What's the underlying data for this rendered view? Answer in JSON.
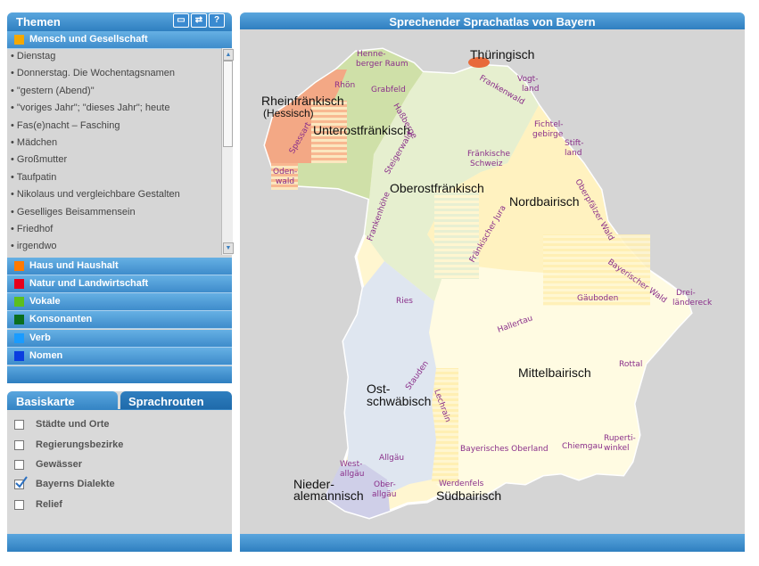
{
  "themes_panel": {
    "title": "Themen",
    "tools": {
      "window": "▭",
      "swap": "⇄",
      "help": "?"
    },
    "active_category": {
      "label": "Mensch und Gesellschaft",
      "color": "#f5a800"
    },
    "items": [
      "• Dienstag",
      "• Donnerstag. Die Wochentagsnamen",
      "• \"gestern (Abend)\"",
      "• \"voriges Jahr\"; \"dieses Jahr\"; heute",
      "• Fas(e)nacht – Fasching",
      "• Mädchen",
      "• Großmutter",
      "• Taufpatin",
      "• Nikolaus und vergleichbare Gestalten",
      "• Geselliges Beisammensein",
      "• Friedhof",
      "• irgendwo"
    ],
    "categories": [
      {
        "label": "Haus und Haushalt",
        "color": "#ff7a00"
      },
      {
        "label": "Natur und Landwirtschaft",
        "color": "#e8001c"
      },
      {
        "label": "Vokale",
        "color": "#5cbf1e"
      },
      {
        "label": "Konsonanten",
        "color": "#0a6e1e"
      },
      {
        "label": "Verb",
        "color": "#1a9cff"
      },
      {
        "label": "Nomen",
        "color": "#0a3de0"
      }
    ]
  },
  "layers_panel": {
    "tab_active": "Basiskarte",
    "tab_other": "Sprachrouten",
    "options": [
      {
        "label": "Städte und Orte",
        "checked": false
      },
      {
        "label": "Regierungsbezirke",
        "checked": false
      },
      {
        "label": "Gewässer",
        "checked": false
      },
      {
        "label": "Bayerns Dialekte",
        "checked": true
      },
      {
        "label": "Relief",
        "checked": false
      }
    ]
  },
  "map": {
    "title": "Sprechender Sprachatlas von Bayern",
    "dialects": {
      "thueringisch": "Thüringisch",
      "rheinfraenkisch": "Rheinfränkisch",
      "hessisch": "(Hessisch)",
      "unterostfraenkisch": "Unterostfränkisch",
      "oberostfraenkisch": "Oberostfränkisch",
      "nordbairisch": "Nordbairisch",
      "mittelbairisch": "Mittelbairisch",
      "ostschwaebisch_1": "Ost-",
      "ostschwaebisch_2": "schwäbisch",
      "niederalemannisch_1": "Nieder-",
      "niederalemannisch_2": "alemannisch",
      "suedbairisch": "Südbairisch"
    },
    "regions": {
      "henneberger_1": "Henne-",
      "henneberger_2": "berger Raum",
      "rhoen": "Rhön",
      "grabfeld": "Grabfeld",
      "hassberge": "Haßberge",
      "spessart": "Spessart",
      "steigerwald": "Steigerwald",
      "odenwald_1": "Oden-",
      "odenwald_2": "wald",
      "frankenwald": "Frankenwald",
      "vogtland_1": "Vogt-",
      "vogtland_2": "land",
      "fichtelgebirge_1": "Fichtel-",
      "fichtelgebirge_2": "gebirge",
      "stiftland_1": "Stift-",
      "stiftland_2": "land",
      "fraenkische_schweiz_1": "Fränkische",
      "fraenkische_schweiz_2": "Schweiz",
      "frankenhoehe": "Frankenhöhe",
      "fraenkischer_jura": "Fränkischer Jura",
      "oberpfaelzer_wald": "Oberpfälzer Wald",
      "bayerischer_wald": "Bayerischer Wald",
      "dreilaendereck_1": "Drei-",
      "dreilaendereck_2": "ländereck",
      "gaeuboden": "Gäuboden",
      "ries": "Ries",
      "hallertau": "Hallertau",
      "rottal": "Rottal",
      "stauden": "Stauden",
      "lechrain": "Lechrain",
      "allgaeu": "Allgäu",
      "westallgaeu_1": "West-",
      "westallgaeu_2": "allgäu",
      "oberallgaeu_1": "Ober-",
      "oberallgaeu_2": "allgäu",
      "bayerisches_oberland": "Bayerisches Oberland",
      "chiemgau": "Chiemgau",
      "rupertiwinkel_1": "Ruperti-",
      "rupertiwinkel_2": "winkel",
      "werdenfels": "Werdenfels"
    }
  }
}
